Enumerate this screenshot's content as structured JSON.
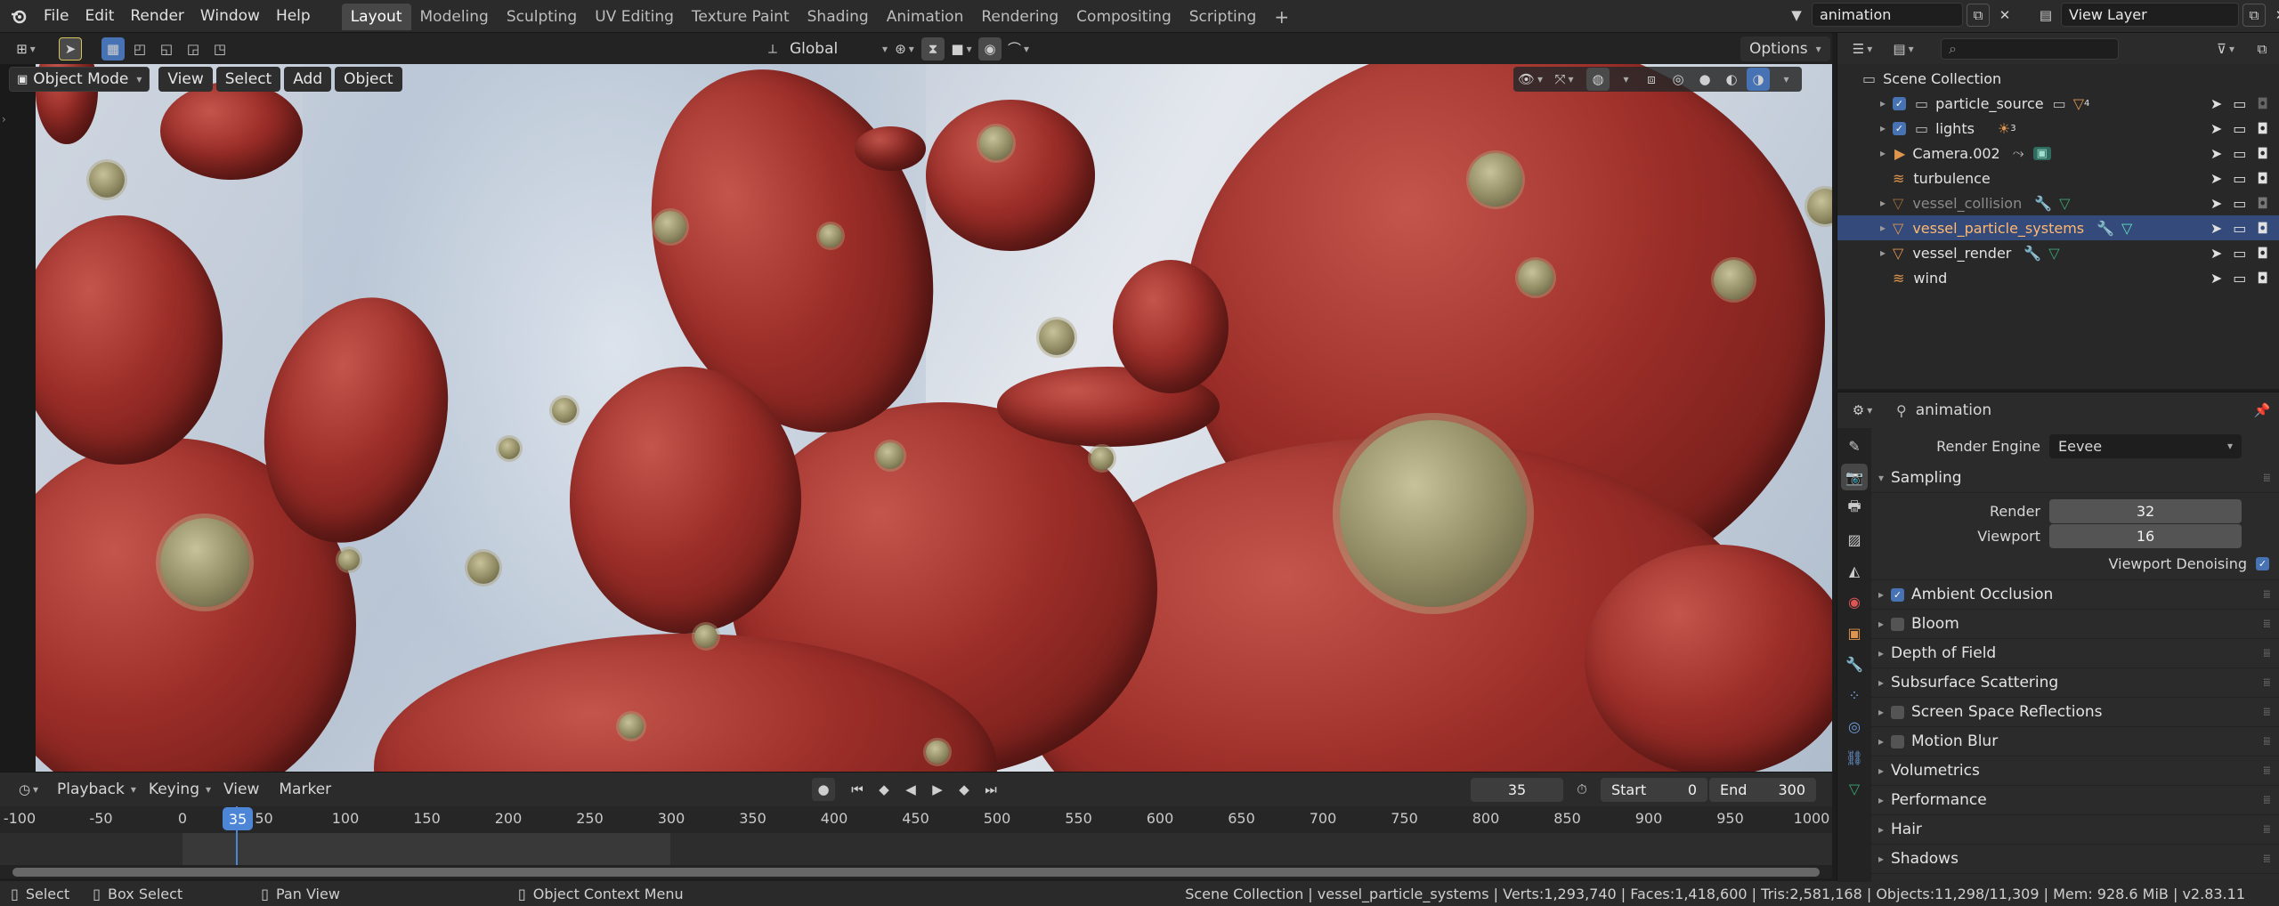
{
  "topbar": {
    "menus": [
      "File",
      "Edit",
      "Render",
      "Window",
      "Help"
    ],
    "workspaces": [
      "Layout",
      "Modeling",
      "Sculpting",
      "UV Editing",
      "Texture Paint",
      "Shading",
      "Animation",
      "Rendering",
      "Compositing",
      "Scripting"
    ],
    "add_tab": "+",
    "scene_name": "animation",
    "view_layer": "View Layer",
    "close_glyph": "✕"
  },
  "tool_header": {
    "orientation": "Global",
    "options": "Options"
  },
  "viewport_header": {
    "mode": "Object Mode",
    "menus": [
      "View",
      "Select",
      "Add",
      "Object"
    ]
  },
  "timeline": {
    "playback": "Playback",
    "keying": "Keying",
    "view": "View",
    "marker": "Marker",
    "current_frame": "35",
    "start_label": "Start",
    "start_value": "0",
    "end_label": "End",
    "end_value": "300",
    "ruler_ticks": [
      "-100",
      "-50",
      "0",
      "50",
      "100",
      "150",
      "200",
      "250",
      "300",
      "350",
      "400",
      "450",
      "500",
      "550",
      "600",
      "650",
      "700",
      "750",
      "800",
      "850",
      "900",
      "950",
      "1000"
    ],
    "playhead": "35"
  },
  "statusbar": {
    "select": "Select",
    "box_select": "Box Select",
    "pan_view": "Pan View",
    "context_menu": "Object Context Menu",
    "stats": "Scene Collection | vessel_particle_systems | Verts:1,293,740 | Faces:1,418,600 | Tris:2,581,168 | Objects:11,298/11,309 | Mem: 928.6 MiB | v2.83.11"
  },
  "outliner": {
    "root": "Scene Collection",
    "items": [
      {
        "name": "particle_source",
        "badge": "4"
      },
      {
        "name": "lights",
        "badge": "3"
      },
      {
        "name": "Camera.002"
      },
      {
        "name": "turbulence"
      },
      {
        "name": "vessel_collision"
      },
      {
        "name": "vessel_particle_systems"
      },
      {
        "name": "vessel_render"
      },
      {
        "name": "wind"
      }
    ]
  },
  "properties": {
    "context": "animation",
    "render_engine_label": "Render Engine",
    "render_engine": "Eevee",
    "sampling": "Sampling",
    "render_label": "Render",
    "render_value": "32",
    "viewport_label": "Viewport",
    "viewport_value": "16",
    "denoise_label": "Viewport Denoising",
    "panels": [
      {
        "label": "Ambient Occlusion",
        "checkbox": true,
        "checked": true
      },
      {
        "label": "Bloom",
        "checkbox": true,
        "checked": false
      },
      {
        "label": "Depth of Field",
        "checkbox": false
      },
      {
        "label": "Subsurface Scattering",
        "checkbox": false
      },
      {
        "label": "Screen Space Reflections",
        "checkbox": true,
        "checked": false
      },
      {
        "label": "Motion Blur",
        "checkbox": true,
        "checked": false
      },
      {
        "label": "Volumetrics",
        "checkbox": false
      },
      {
        "label": "Performance",
        "checkbox": false
      },
      {
        "label": "Hair",
        "checkbox": false
      },
      {
        "label": "Shadows",
        "checkbox": false
      }
    ]
  },
  "colors": {
    "accent": "#4772b3",
    "selection": "#334a7a",
    "playhead": "#4d86d6",
    "object_orange": "#e0954d"
  }
}
